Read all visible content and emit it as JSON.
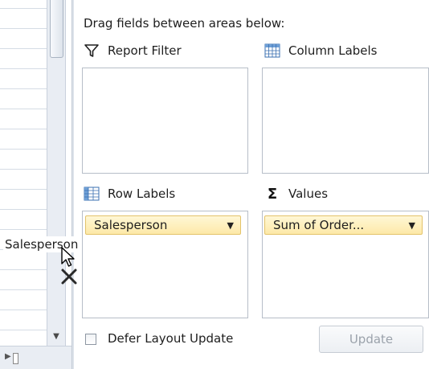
{
  "field_list": {
    "instruction": "Drag fields between areas below:",
    "areas": {
      "report_filter": {
        "label": "Report Filter",
        "icon": "filter-icon"
      },
      "column_labels": {
        "label": "Column Labels",
        "icon": "column-grid-icon"
      },
      "row_labels": {
        "label": "Row Labels",
        "icon": "row-grid-icon",
        "fields": [
          "Salesperson"
        ]
      },
      "values": {
        "label": "Values",
        "icon": "sigma-icon",
        "fields": [
          "Sum of Order..."
        ]
      }
    },
    "defer_layout_update": {
      "label": "Defer Layout Update",
      "checked": false
    },
    "update_button": {
      "label": "Update",
      "enabled": false
    }
  },
  "drag": {
    "ghost_label": "Salesperson",
    "cursor_icon": "drag-arrow-cursor-icon",
    "remove_icon": "remove-x-icon"
  },
  "colors": {
    "pill_fill": "#fde9a8",
    "pill_border": "#e3c36a",
    "box_border": "#b7bec8",
    "grid_icon_blue": "#3a6fb0"
  }
}
